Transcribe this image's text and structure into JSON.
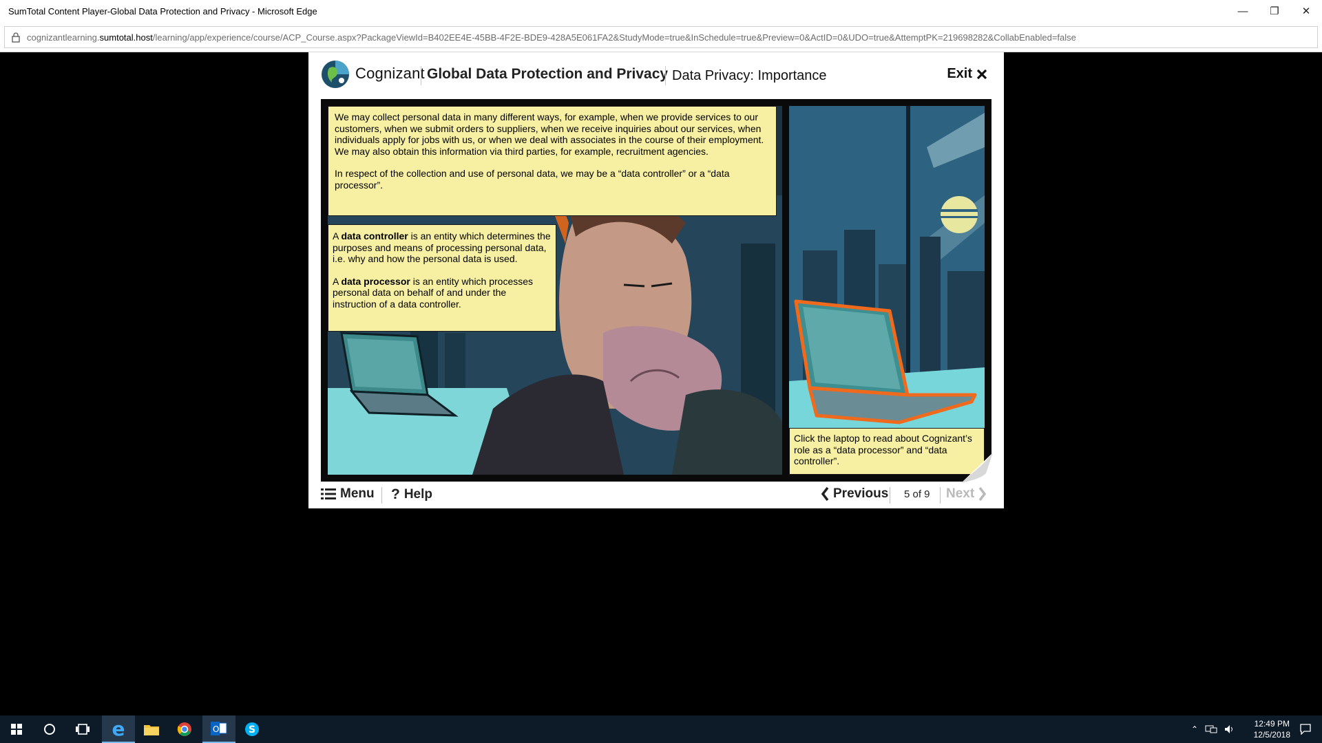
{
  "browser": {
    "window_title": "SumTotal Content Player-Global Data Protection and Privacy - Microsoft Edge",
    "url_prefix": "cognizantlearning.",
    "url_host": "sumtotal.host",
    "url_path": "/learning/app/experience/course/ACP_Course.aspx?PackageViewId=B402EE4E-45BB-4F2E-BDE9-428A5E061FA2&StudyMode=true&InSchedule=true&Preview=0&ActID=0&UDO=true&AttemptPK=219698282&CollabEnabled=false"
  },
  "player": {
    "brand": "Cognizant",
    "course_title": "Global Data Protection and Privacy",
    "page_title": "Data Privacy: Importance",
    "exit_label": "Exit",
    "caption_top": {
      "p1": "We may collect personal data in many different ways, for example, when we provide services to our customers, when we submit orders to suppliers, when we receive inquiries about our services, when individuals apply for jobs with us, or when we deal with associates in the course of their employment. We may also obtain this information via third parties, for example, recruitment agencies.",
      "p2": "In respect of the collection and use of personal data, we may be a “data controller” or a “data processor”."
    },
    "definitions": {
      "controller_a": "A",
      "controller_term": "data controller",
      "controller_text": "is an entity which determines the purposes and means of processing personal data, i.e. why and how the personal data is used.",
      "processor_a": "A",
      "processor_term": "data processor",
      "processor_text": "is an entity which processes personal data on behalf of and under the instruction of a data controller."
    },
    "side_caption": "Click the laptop to read about Cognizant’s role as a “data processor” and “data controller”.",
    "footer": {
      "menu_label": "Menu",
      "help_label": "Help",
      "previous_label": "Previous",
      "page_counter": "5 of 9",
      "next_label": "Next"
    }
  },
  "taskbar": {
    "time": "12:49 PM",
    "date": "12/5/2018"
  },
  "colors": {
    "caption_bg": "#f7f0a2",
    "laptop_highlight": "#f06a1d",
    "taskbar_bg": "#0d1a28"
  }
}
